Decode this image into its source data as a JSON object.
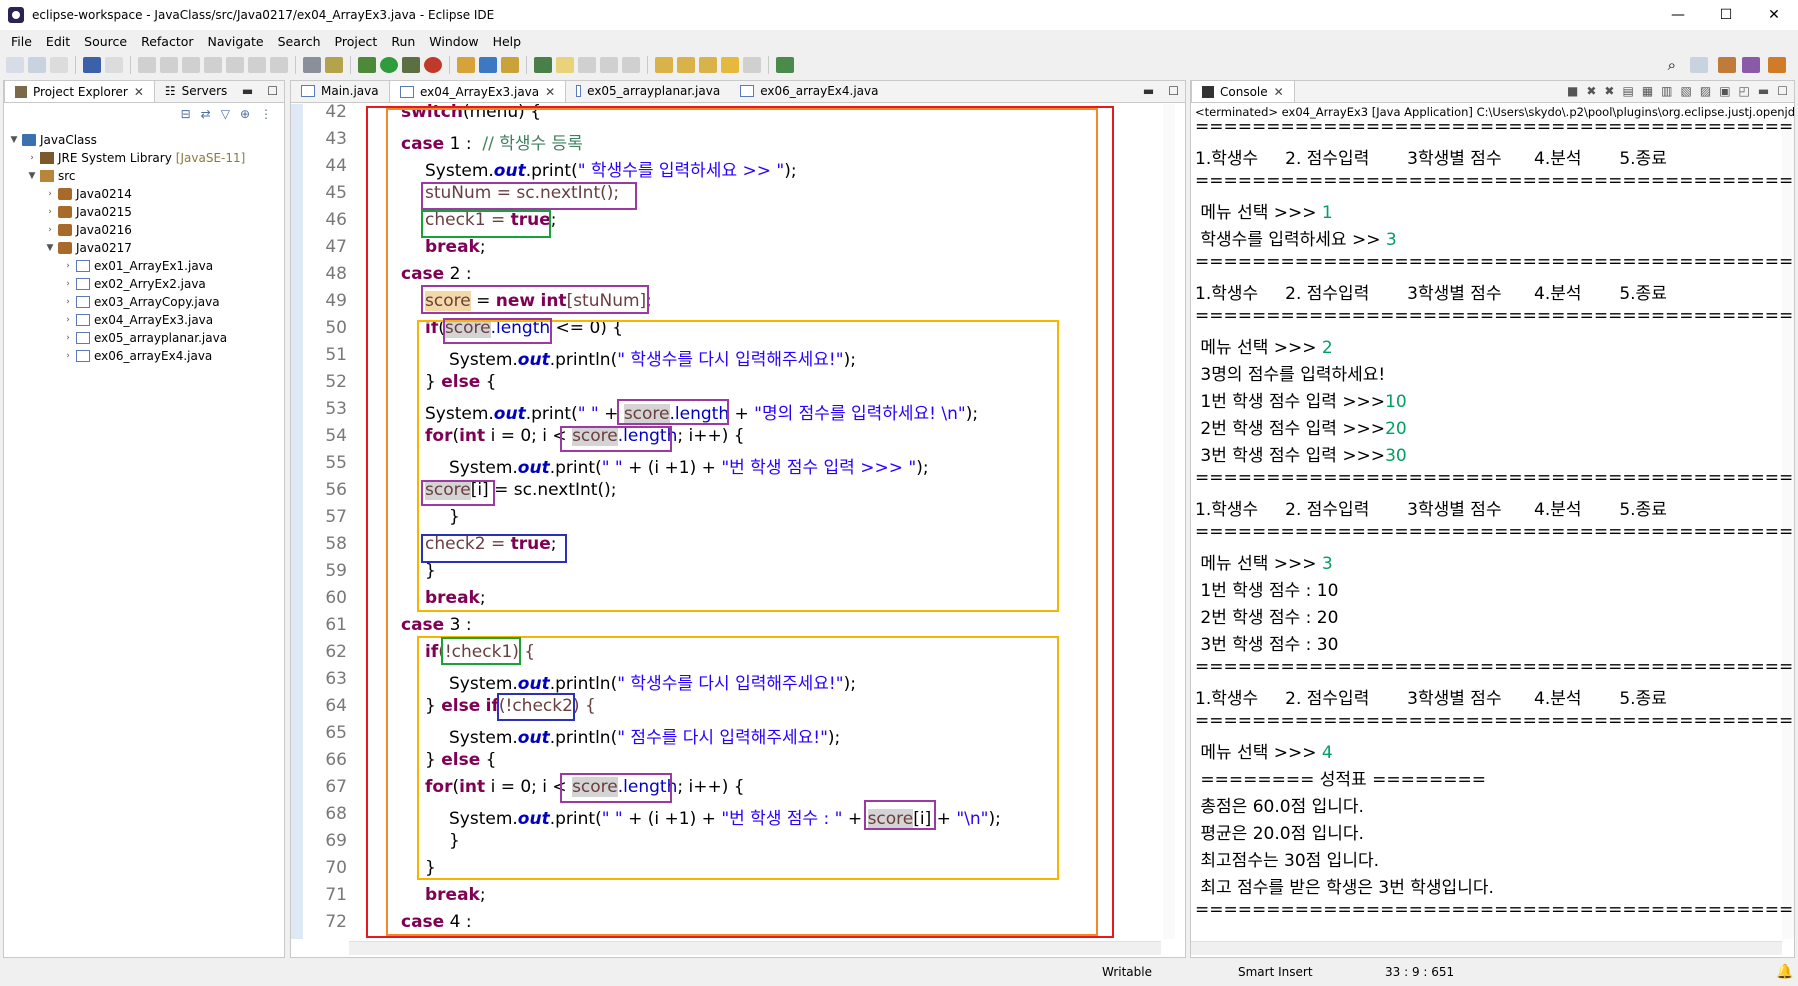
{
  "window": {
    "title": "eclipse-workspace - JavaClass/src/Java0217/ex04_ArrayEx3.java - Eclipse IDE",
    "minimize": "—",
    "maximize": "☐",
    "close": "✕"
  },
  "menu": [
    "File",
    "Edit",
    "Source",
    "Refactor",
    "Navigate",
    "Search",
    "Project",
    "Run",
    "Window",
    "Help"
  ],
  "left_tabs": {
    "explorer": "Project Explorer",
    "servers": "Servers"
  },
  "tree": [
    {
      "label": "JavaClass",
      "level": 0,
      "icon": "project-icon",
      "open": true
    },
    {
      "label": "JRE System Library",
      "extra": "[JavaSE-11]",
      "level": 1,
      "icon": "library-icon"
    },
    {
      "label": "src",
      "level": 1,
      "icon": "source-folder-icon",
      "open": true
    },
    {
      "label": "Java0214",
      "level": 2,
      "icon": "package-icon"
    },
    {
      "label": "Java0215",
      "level": 2,
      "icon": "package-icon"
    },
    {
      "label": "Java0216",
      "level": 2,
      "icon": "package-icon"
    },
    {
      "label": "Java0217",
      "level": 2,
      "icon": "package-icon",
      "open": true
    },
    {
      "label": "ex01_ArrayEx1.java",
      "level": 3,
      "icon": "java-file-icon"
    },
    {
      "label": "ex02_ArryEx2.java",
      "level": 3,
      "icon": "java-file-icon"
    },
    {
      "label": "ex03_ArrayCopy.java",
      "level": 3,
      "icon": "java-file-icon"
    },
    {
      "label": "ex04_ArrayEx3.java",
      "level": 3,
      "icon": "java-file-icon"
    },
    {
      "label": "ex05_arrayplanar.java",
      "level": 3,
      "icon": "java-file-icon"
    },
    {
      "label": "ex06_arrayEx4.java",
      "level": 3,
      "icon": "java-file-icon"
    }
  ],
  "editor_tabs": [
    "Main.java",
    "ex04_ArrayEx3.java",
    "ex05_arrayplanar.java",
    "ex06_arrayEx4.java"
  ],
  "line_numbers": [
    "42",
    "43",
    "44",
    "45",
    "46",
    "47",
    "48",
    "49",
    "50",
    "51",
    "52",
    "53",
    "54",
    "55",
    "56",
    "57",
    "58",
    "59",
    "60",
    "61",
    "62",
    "63",
    "64",
    "65",
    "66",
    "67",
    "68",
    "69",
    "70",
    "71",
    "72"
  ],
  "code": {
    "l42_kw": "switch",
    "l42_rest": "(menu) {",
    "case": "case",
    "l43_num": " 1 :  ",
    "l43_cm": "// 학생수 등록",
    "sys": "System.",
    "out": "out",
    "print": ".print(",
    "println": ".println(",
    "l44_str": "\" 학생수를 입력하세요 >> \"",
    "l44_end": ");",
    "l45": "stuNum = sc.nextInt();",
    "l46_a": "check1 = ",
    "true": "true",
    "semi": ";",
    "break": "break",
    "l48_num": " 2 :",
    "score": "score",
    "l49_mid": " = ",
    "new": "new",
    "int": "int",
    "l49_end": "[stuNum];",
    "if": "if",
    "l50_a": "(",
    "length": ".length",
    "l50_b": " <= 0) {",
    "l51_str": "\" 학생수를 다시 입력해주세요!\"",
    "else": "else",
    "l52_a": "} ",
    "l52_b": " {",
    "l53_a": "\" \"",
    "plus": " + ",
    "l53_str": "\"명의 점수를 입력하세요! \\n\"",
    "for": "for",
    "l54_a": "(",
    "l54_b": " i = 0; i < ",
    "l54_c": "; i++) {",
    "l55_a": "\" \"",
    "l55_b": " + (i +1) + ",
    "l55_str": "\"번 학생 점수 입력 >>> \"",
    "l56_a": "[i]",
    "l56_b": " = sc.nextInt();",
    "close": "}",
    "l58_a": "check2 = ",
    "l61_num": " 3 :",
    "l62_a": "(!check1) {",
    "l63_str": "\" 학생수를 다시 입력해주세요!\"",
    "l64_a": "} ",
    "l64_b": " ",
    "l64_c": "(!check2) {",
    "l65_str": "\" 점수를 다시 입력해주세요!\"",
    "l68_str": "\"번 학생 점수 : \"",
    "l68_end": "\"\\n\"",
    "l72_num": " 4 :"
  },
  "console": {
    "tab": "Console",
    "header": "<terminated> ex04_ArrayEx3 [Java Application] C:\\Users\\skydo\\.p2\\pool\\plugins\\org.eclipse.justj.openjdk.h",
    "sep": "==============================================",
    "menu_line": "1.학생수     2. 점수입력       3학생별 점수      4.분석       5.종료",
    "sel": " 메뉴 선택 >>> ",
    "in1": "1",
    "ask": " 학생수를 입력하세요 >> ",
    "in3": "3",
    "in2": "2",
    "l_three": " 3명의 점수를 입력하세요!",
    "p1": " 1번 학생 점수 입력 >>>",
    "v10": "10",
    "p2": " 2번 학생 점수 입력 >>>",
    "v20": "20",
    "p3": " 3번 학생 점수 입력 >>>",
    "v30": "30",
    "in3b": "3",
    "s1": " 1번 학생 점수 : 10",
    "s2": " 2번 학생 점수 : 20",
    "s3": " 3번 학생 점수 : 30",
    "in4": "4",
    "r0": " ======== 성적표 ========",
    "r1": " 총점은 60.0점 입니다.",
    "r2": " 평균은 20.0점 입니다.",
    "r3": " 최고점수는 30점 입니다.",
    "r4": " 최고 점수를 받은 학생은 3번 학생입니다."
  },
  "status": {
    "writable": "Writable",
    "insert": "Smart Insert",
    "pos": "33 : 9 : 651"
  },
  "colors": {
    "red_box": "#e8191e",
    "orange_box": "#f08a24",
    "yellow_box": "#f7b500",
    "purple_box": "#9b3aa0",
    "green_box": "#1aa23a",
    "blue_box": "#2c2fb8"
  }
}
